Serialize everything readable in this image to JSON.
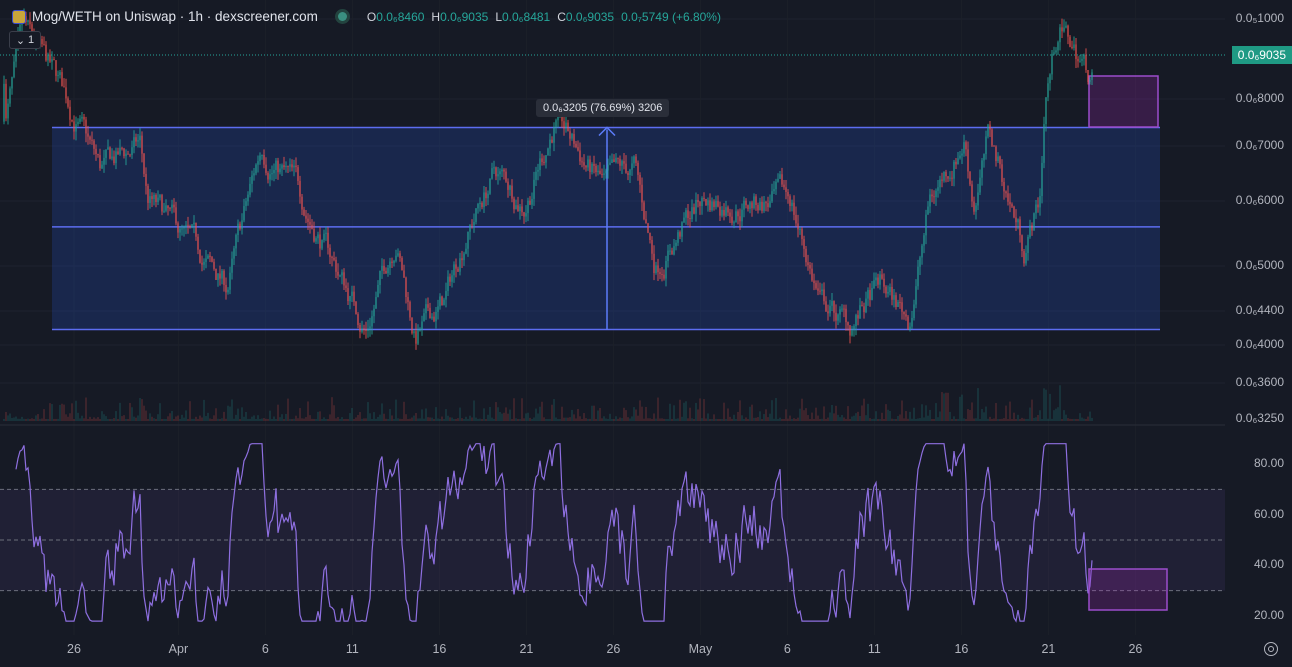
{
  "header": {
    "title": "Mog/WETH on Uniswap · 1h · dexscreener.com",
    "ohlc": {
      "o_label": "O",
      "o": "0.0₆8460",
      "h_label": "H",
      "h": "0.0₆9035",
      "l_label": "L",
      "l": "0.0₆8481",
      "c_label": "C",
      "c": "0.0₆9035",
      "change": "0.0₇5749 (+6.80%)"
    },
    "indicator_toggle": "1"
  },
  "measure_label": "0.0₆3205 (76.69%) 3206",
  "price_axis": [
    {
      "label": "0.0₅1000",
      "value": 1.0
    },
    {
      "label": "0.0₆8000",
      "value": 0.8
    },
    {
      "label": "0.0₆7000",
      "value": 0.7
    },
    {
      "label": "0.0₆6000",
      "value": 0.6
    },
    {
      "label": "0.0₆5000",
      "value": 0.5
    },
    {
      "label": "0.0₆4400",
      "value": 0.44
    },
    {
      "label": "0.0₆4000",
      "value": 0.4
    },
    {
      "label": "0.0₆3600",
      "value": 0.36
    },
    {
      "label": "0.0₆3250",
      "value": 0.325
    }
  ],
  "current_price": {
    "label": "0.0₆9035",
    "value": 0.9035
  },
  "rsi_axis": [
    {
      "label": "80.00",
      "value": 80
    },
    {
      "label": "60.00",
      "value": 60
    },
    {
      "label": "40.00",
      "value": 40
    },
    {
      "label": "20.00",
      "value": 20
    }
  ],
  "time_axis": [
    {
      "label": "26",
      "day": 0
    },
    {
      "label": "Apr",
      "day": 6
    },
    {
      "label": "6",
      "day": 11
    },
    {
      "label": "11",
      "day": 16
    },
    {
      "label": "16",
      "day": 21
    },
    {
      "label": "21",
      "day": 26
    },
    {
      "label": "26",
      "day": 31
    },
    {
      "label": "May",
      "day": 36
    },
    {
      "label": "6",
      "day": 41
    },
    {
      "label": "11",
      "day": 46
    },
    {
      "label": "16",
      "day": 51
    },
    {
      "label": "21",
      "day": 56
    },
    {
      "label": "26",
      "day": 61
    }
  ],
  "colors": {
    "up": "#26a69a",
    "down": "#ef5350",
    "rsi": "#7e57c2",
    "range": "#2962ff",
    "box": "#9c27b0",
    "bg": "#161a25"
  },
  "chart_data": {
    "type": "candlestick",
    "unit": "price in 1e-6 ETH (0.0₆)",
    "price_path_days": [
      -4,
      -2.9,
      -0.4,
      1.5,
      3.8,
      4.2,
      8.8,
      10.8,
      12.8,
      16.8,
      18.5,
      19.6,
      21.3,
      22.5,
      24.2,
      25.9,
      27.6,
      29.1,
      30.5,
      32.2,
      33.4,
      36,
      38.3,
      41.2,
      42.9,
      44.6,
      46.3,
      48,
      49.2,
      51.2,
      51.7,
      52.6,
      54.6,
      55.5,
      55.8,
      56.6,
      58.3
    ],
    "price_path_values": [
      0.75,
      0.95,
      0.8,
      0.65,
      0.7,
      0.6,
      0.47,
      0.7,
      0.62,
      0.42,
      0.55,
      0.41,
      0.45,
      0.55,
      0.65,
      0.6,
      0.75,
      0.68,
      0.62,
      0.65,
      0.5,
      0.6,
      0.6,
      0.6,
      0.45,
      0.42,
      0.47,
      0.43,
      0.6,
      0.72,
      0.6,
      0.72,
      0.53,
      0.6,
      0.8,
      0.98,
      0.86
    ],
    "range_levels": [
      0.7378,
      0.558,
      0.4178
    ],
    "rsi_bands": [
      70,
      50,
      30
    ],
    "rsi_range": [
      15,
      90
    ]
  }
}
